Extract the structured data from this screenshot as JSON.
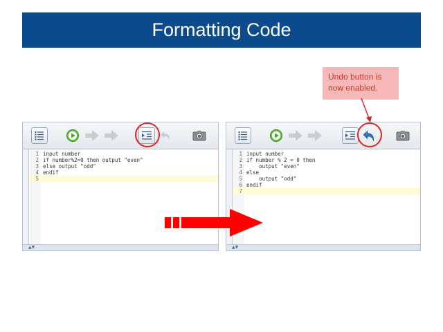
{
  "slide": {
    "title": "Formatting Code",
    "callout": "Undo button is now enabled."
  },
  "left_panel": {
    "toolbar": {
      "outline_icon": "outline-icon",
      "run_icon": "play-icon",
      "step_icon": "step-arrow-icon",
      "step_over_icon": "step-over-icon",
      "format_icon": "format-code-icon",
      "undo_icon": "undo-icon",
      "undo_enabled": false,
      "screenshot_icon": "camera-icon"
    },
    "code": [
      {
        "num": "1",
        "text": "input number"
      },
      {
        "num": "2",
        "text": "if number%2=0 then output \"even\""
      },
      {
        "num": "3",
        "text": "else output \"odd\""
      },
      {
        "num": "4",
        "text": "endif"
      },
      {
        "num": "5",
        "text": ""
      }
    ],
    "current_line": 5,
    "status": "▲▼"
  },
  "right_panel": {
    "toolbar": {
      "outline_icon": "outline-icon",
      "run_icon": "play-icon",
      "step_icon": "step-arrow-icon",
      "step_over_icon": "step-over-icon",
      "format_icon": "format-code-icon",
      "undo_icon": "undo-icon",
      "undo_enabled": true,
      "screenshot_icon": "camera-icon"
    },
    "code": [
      {
        "num": "1",
        "text": "input number"
      },
      {
        "num": "2",
        "text": "if number % 2 = 0 then"
      },
      {
        "num": "3",
        "text": "    output \"even\""
      },
      {
        "num": "4",
        "text": "else"
      },
      {
        "num": "5",
        "text": "    output \"odd\""
      },
      {
        "num": "6",
        "text": "endif"
      },
      {
        "num": "7",
        "text": ""
      }
    ],
    "current_line": 7,
    "status": "▲▼"
  },
  "colors": {
    "banner": "#0b4a8b",
    "highlight_ring": "#e02424",
    "arrow": "#ff0000",
    "callout_bg": "#f6b8b8",
    "callout_text": "#c0392b",
    "current_line": "#fffbd8"
  }
}
